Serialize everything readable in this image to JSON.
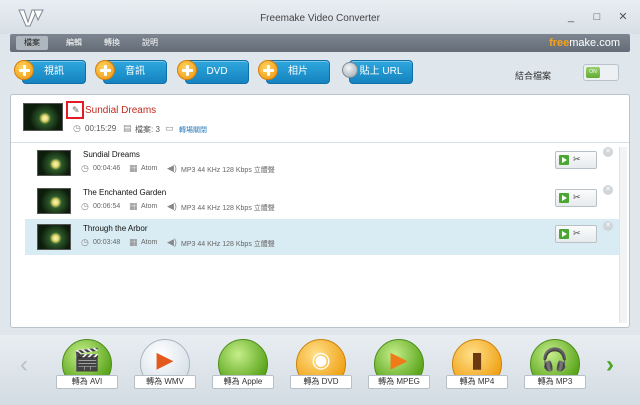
{
  "window": {
    "title": "Freemake Video Converter",
    "controls": {
      "minimize": "_",
      "maximize": "□",
      "close": "✕"
    }
  },
  "menu": {
    "items": [
      "檔案",
      "編輯",
      "轉換",
      "說明"
    ],
    "brand_free": "free",
    "brand_rest": "make.com"
  },
  "toolbar": {
    "video": "視訊",
    "audio": "音訊",
    "dvd": "DVD",
    "photo": "相片",
    "paste_url": "貼上 URL",
    "merge_label": "結合檔案",
    "merge_toggle": "ON"
  },
  "group": {
    "title": "Sundial Dreams",
    "duration": "00:15:29",
    "file_count": "檔案: 3",
    "link": "轉場關閉"
  },
  "files": [
    {
      "title": "Sundial Dreams",
      "duration": "00:04:46",
      "codec": "Atom",
      "audio": "MP3  44 KHz  128 Kbps  立體聲",
      "selected": false
    },
    {
      "title": "The Enchanted Garden",
      "duration": "00:06:54",
      "codec": "Atom",
      "audio": "MP3  44 KHz  128 Kbps  立體聲",
      "selected": false
    },
    {
      "title": "Through the Arbor",
      "duration": "00:03:48",
      "codec": "Atom",
      "audio": "MP3  44 KHz  128 Kbps  立體聲",
      "selected": true
    }
  ],
  "converters": [
    {
      "label": "轉為 AVI",
      "icon": "clapper-icon",
      "glyph": "🎬",
      "color": "#6cba2a"
    },
    {
      "label": "轉為 WMV",
      "icon": "windows-media-icon",
      "glyph": "▶",
      "color": "#e35a1f"
    },
    {
      "label": "轉為 Apple",
      "icon": "apple-icon",
      "glyph": "",
      "color": "#6cba2a"
    },
    {
      "label": "轉為 DVD",
      "icon": "dvd-disc-icon",
      "glyph": "◉",
      "color": "#f0a318"
    },
    {
      "label": "轉為 MPEG",
      "icon": "tv-icon",
      "glyph": "▶",
      "color": "#6cba2a"
    },
    {
      "label": "轉為 MP4",
      "icon": "phone-icon",
      "glyph": "▮",
      "color": "#f0a318"
    },
    {
      "label": "轉為 MP3",
      "icon": "headphones-icon",
      "glyph": "🎧",
      "color": "#6cba2a"
    }
  ],
  "nav": {
    "prev": "‹",
    "next": "›"
  }
}
